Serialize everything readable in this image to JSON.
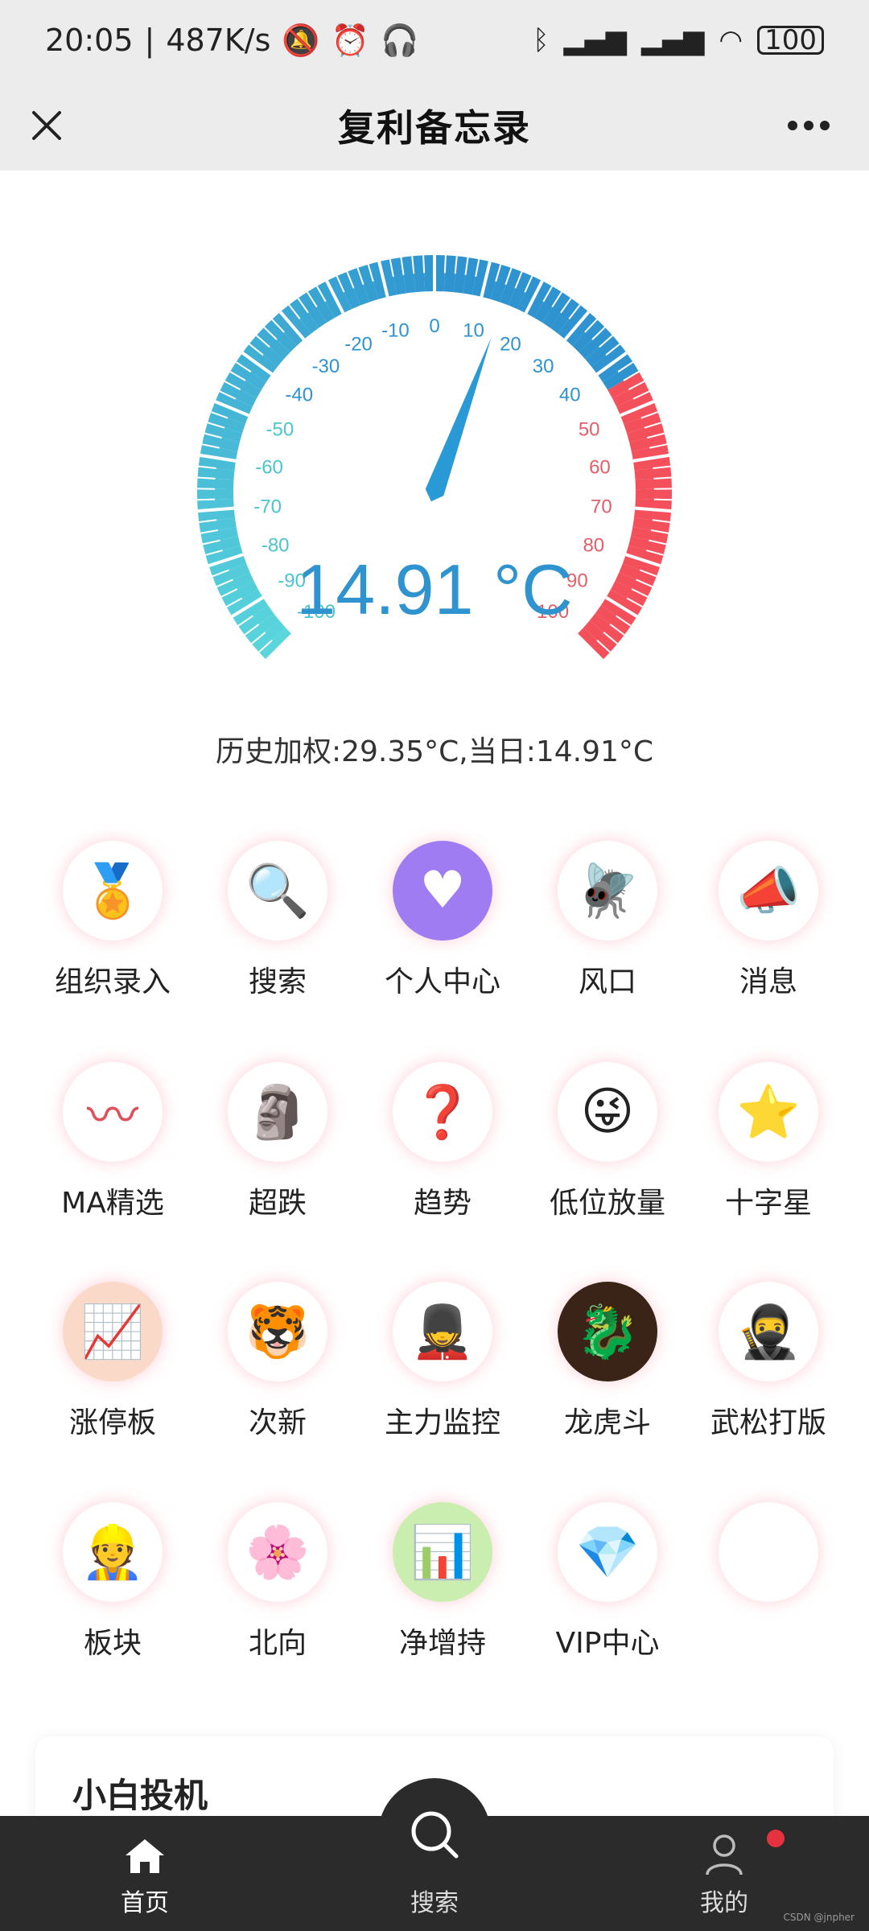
{
  "status_bar": {
    "time": "20:05",
    "speed": "487K/s",
    "battery": "100"
  },
  "header": {
    "title": "复利备忘录"
  },
  "gauge": {
    "reading": "14.91 °C",
    "value": 14.91,
    "min": -100,
    "max": 100,
    "tick_labels": [
      "-100",
      "-90",
      "-80",
      "-70",
      "-60",
      "-50",
      "-40",
      "-30",
      "-20",
      "-10",
      "0",
      "10",
      "20",
      "30",
      "40",
      "50",
      "60",
      "70",
      "80",
      "90",
      "100"
    ],
    "colors": {
      "cold": "#5ad6dc",
      "mid": "#2e93cf",
      "hot": "#f4505c",
      "needle": "#2a9ad6"
    }
  },
  "summary": "历史加权:29.35°C,当日:14.91°C",
  "menu": [
    {
      "label": "组织录入",
      "icon": "award-team-icon"
    },
    {
      "label": "搜索",
      "icon": "magnifier-icon"
    },
    {
      "label": "个人中心",
      "icon": "heart-icon"
    },
    {
      "label": "风口",
      "icon": "dragonfly-icon"
    },
    {
      "label": "消息",
      "icon": "megaphone-icon"
    },
    {
      "label": "MA精选",
      "icon": "heartbeat-icon"
    },
    {
      "label": "超跌",
      "icon": "statue-icon"
    },
    {
      "label": "趋势",
      "icon": "trend-icon"
    },
    {
      "label": "低位放量",
      "icon": "cartoon-boy-icon"
    },
    {
      "label": "十字星",
      "icon": "star-flag-icon"
    },
    {
      "label": "涨停板",
      "icon": "rising-coins-icon"
    },
    {
      "label": "次新",
      "icon": "tiger-icon"
    },
    {
      "label": "主力监控",
      "icon": "soldier-icon"
    },
    {
      "label": "龙虎斗",
      "icon": "dragon-tiger-icon"
    },
    {
      "label": "武松打版",
      "icon": "warrior-icon"
    },
    {
      "label": "板块",
      "icon": "builder-icon"
    },
    {
      "label": "北向",
      "icon": "blossom-icon"
    },
    {
      "label": "净增持",
      "icon": "growth-chart-icon"
    },
    {
      "label": "VIP中心",
      "icon": "diamond-icon"
    },
    {
      "label": "",
      "icon": "blank-icon"
    }
  ],
  "card": {
    "title": "小白投机"
  },
  "tabs": {
    "home": "首页",
    "search": "搜索",
    "mine": "我的"
  },
  "watermark": "CSDN @jnpher"
}
